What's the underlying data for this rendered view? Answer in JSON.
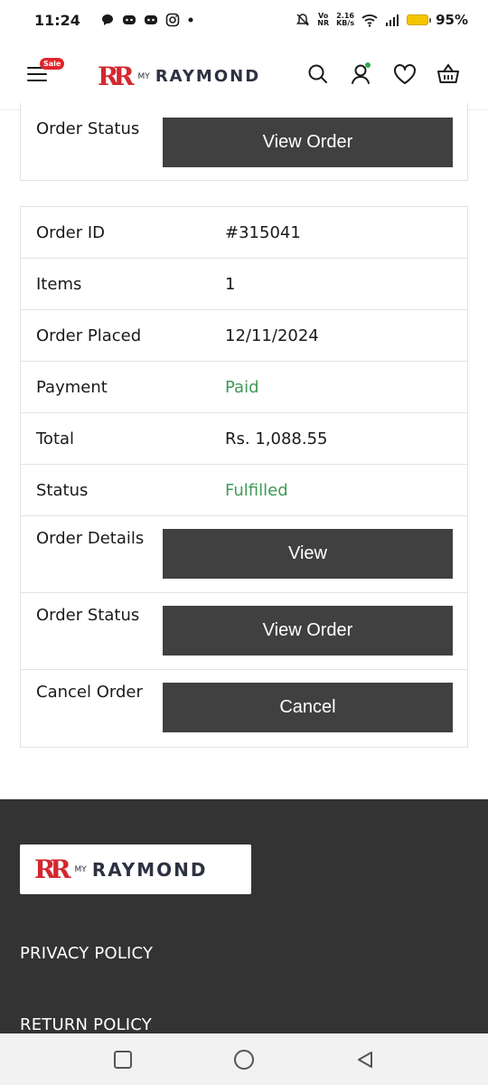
{
  "status_bar": {
    "time": "11:24",
    "network_top": "Vo",
    "network_bottom": "NR",
    "speed_top": "2.16",
    "speed_bottom": "KB/s",
    "battery": "95%"
  },
  "header": {
    "sale_badge": "Sale",
    "logo_my": "MY",
    "logo_name": "RAYMOND"
  },
  "top_card": {
    "label": "Order Status",
    "button": "View Order"
  },
  "order": {
    "rows": [
      {
        "label": "Order ID",
        "value": "#315041"
      },
      {
        "label": "Items",
        "value": "1"
      },
      {
        "label": "Order Placed",
        "value": "12/11/2024"
      },
      {
        "label": "Payment",
        "value": "Paid"
      },
      {
        "label": "Total",
        "value": "Rs. 1,088.55"
      },
      {
        "label": "Status",
        "value": "Fulfilled"
      }
    ],
    "actions": [
      {
        "label": "Order Details",
        "button": "View"
      },
      {
        "label": "Order Status",
        "button": "View Order"
      },
      {
        "label": "Cancel Order",
        "button": "Cancel"
      }
    ]
  },
  "footer": {
    "logo_my": "MY",
    "logo_name": "RAYMOND",
    "links": [
      "PRIVACY POLICY",
      "RETURN POLICY"
    ]
  },
  "colors": {
    "accent_green": "#3f9a56",
    "button_dark": "#404040",
    "footer_bg": "#333333",
    "brand_red": "#d3282f"
  }
}
